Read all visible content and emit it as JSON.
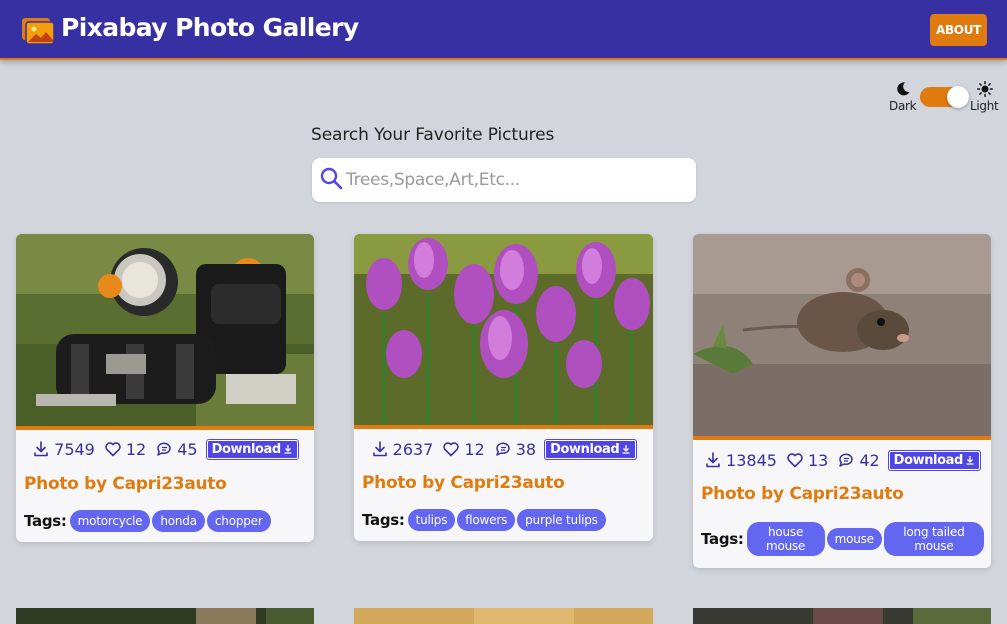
{
  "app": {
    "title": "Pixabay Photo Gallery",
    "about_label": "ABOUT",
    "brand_color": "#3730a3",
    "accent_color": "#e07b0f"
  },
  "theme_toggle": {
    "dark_label": "Dark",
    "light_label": "Light",
    "state": "light"
  },
  "search": {
    "label": "Search Your Favorite Pictures",
    "placeholder": "Trees,Space,Art,Etc...",
    "value": ""
  },
  "cards": [
    {
      "image": "motorcycle",
      "downloads": "7549",
      "likes": "12",
      "comments": "45",
      "download_label": "Download",
      "author": "Photo by Capri23auto",
      "tags_label": "Tags:",
      "tags": [
        "motorcycle",
        "honda",
        "chopper"
      ]
    },
    {
      "image": "tulips",
      "downloads": "2637",
      "likes": "12",
      "comments": "38",
      "download_label": "Download",
      "author": "Photo by Capri23auto",
      "tags_label": "Tags:",
      "tags": [
        "tulips",
        "flowers",
        "purple tulips"
      ]
    },
    {
      "image": "mouse",
      "downloads": "13845",
      "likes": "13",
      "comments": "42",
      "download_label": "Download",
      "author": "Photo by Capri23auto",
      "tags_label": "Tags:",
      "tags": [
        "house mouse",
        "mouse",
        "long tailed mouse"
      ]
    }
  ]
}
